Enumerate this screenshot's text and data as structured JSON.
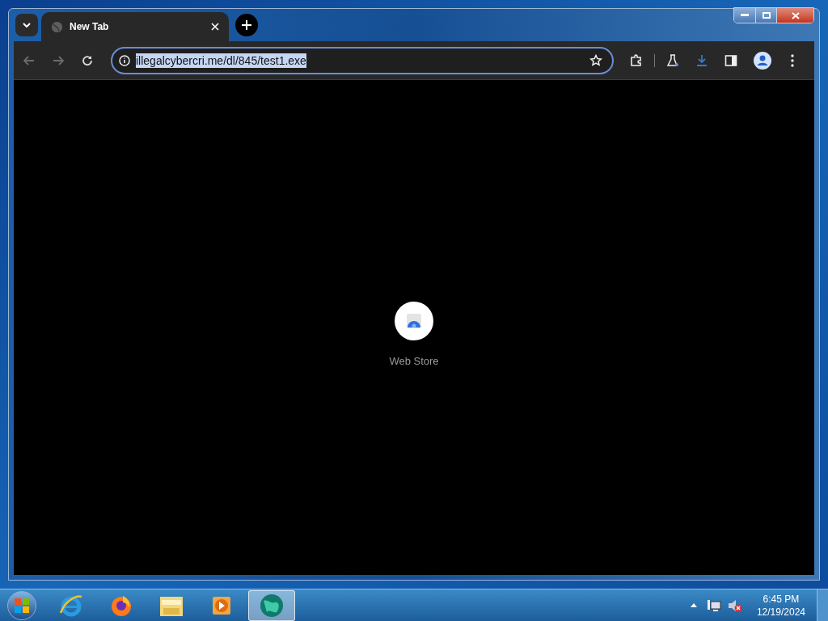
{
  "tabs": [
    {
      "title": "New Tab",
      "selected": true
    }
  ],
  "address_bar": {
    "url": "illegalcybercri.me/dl/845/test1.exe",
    "url_selected": true
  },
  "shortcuts": [
    {
      "label": "Web Store"
    }
  ],
  "taskbar": {
    "apps": [
      {
        "kind": "browser-e",
        "selected": false
      },
      {
        "kind": "fox",
        "selected": false
      },
      {
        "kind": "folder",
        "selected": false
      },
      {
        "kind": "player",
        "selected": false
      },
      {
        "kind": "globe",
        "selected": true
      }
    ],
    "time": "6:45 PM",
    "date": "12/19/2024"
  }
}
